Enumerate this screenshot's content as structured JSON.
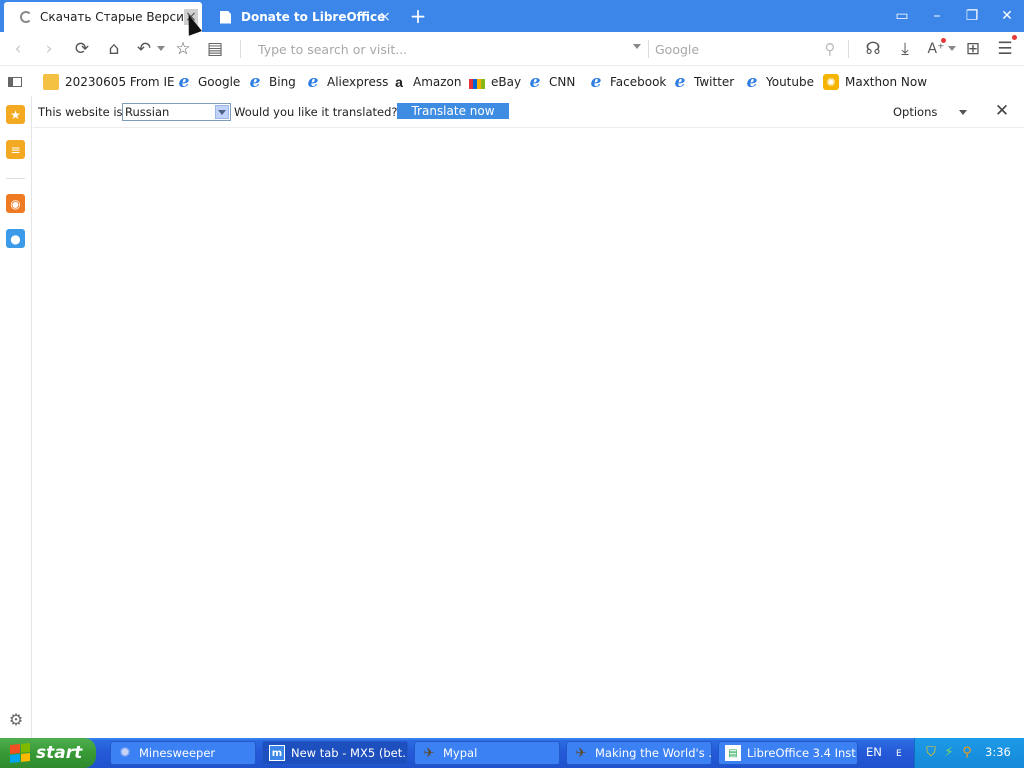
{
  "browser": {
    "tabs": [
      {
        "title": "Скачать Старые Версии L",
        "state": "loading",
        "close": "×"
      },
      {
        "title": "Donate to LibreOffice | Libr",
        "close": "×"
      }
    ],
    "new_tab": "+",
    "window_controls": {
      "layout": "▭",
      "minimize": "–",
      "restore": "❐",
      "close": "✕"
    }
  },
  "toolbar": {
    "url_placeholder": "Type to search or visit...",
    "search_placeholder": "Google",
    "icons": [
      "back-icon",
      "forward-icon",
      "reload-icon",
      "home-icon",
      "undo-icon",
      "star-icon",
      "notes-icon",
      "search-icon",
      "speech-icon",
      "download-icon",
      "translate-icon",
      "apps-icon",
      "menu-icon"
    ]
  },
  "bookmarks": [
    {
      "label": "20230605 From IE",
      "icon": "folder"
    },
    {
      "label": "Google",
      "icon": "ie"
    },
    {
      "label": "Bing",
      "icon": "ie"
    },
    {
      "label": "Aliexpress",
      "icon": "ie"
    },
    {
      "label": "Amazon",
      "icon": "amazon"
    },
    {
      "label": "eBay",
      "icon": "ebay"
    },
    {
      "label": "CNN",
      "icon": "ie"
    },
    {
      "label": "Facebook",
      "icon": "ie"
    },
    {
      "label": "Twitter",
      "icon": "ie"
    },
    {
      "label": "Youtube",
      "icon": "ie"
    },
    {
      "label": "Maxthon Now",
      "icon": "maxthon"
    }
  ],
  "translate_bar": {
    "prefix": "This website is in",
    "language": "Russian",
    "question": "Would you like it translated?",
    "button": "Translate now",
    "options": "Options",
    "close": "✕"
  },
  "taskbar": {
    "start": "start",
    "tasks": [
      {
        "label": "Minesweeper"
      },
      {
        "label": "New tab - MX5 (bet..."
      },
      {
        "label": "Mypal"
      },
      {
        "label": "Making the World's ..."
      },
      {
        "label": "LibreOffice 3.4 Inst..."
      }
    ],
    "language": "EN",
    "language_sub": "E",
    "clock": "3:36"
  },
  "colors": {
    "accent": "#3b86e8",
    "taskbar": "#2459d8",
    "start": "#379a35",
    "translate_button": "#3f8de3"
  }
}
